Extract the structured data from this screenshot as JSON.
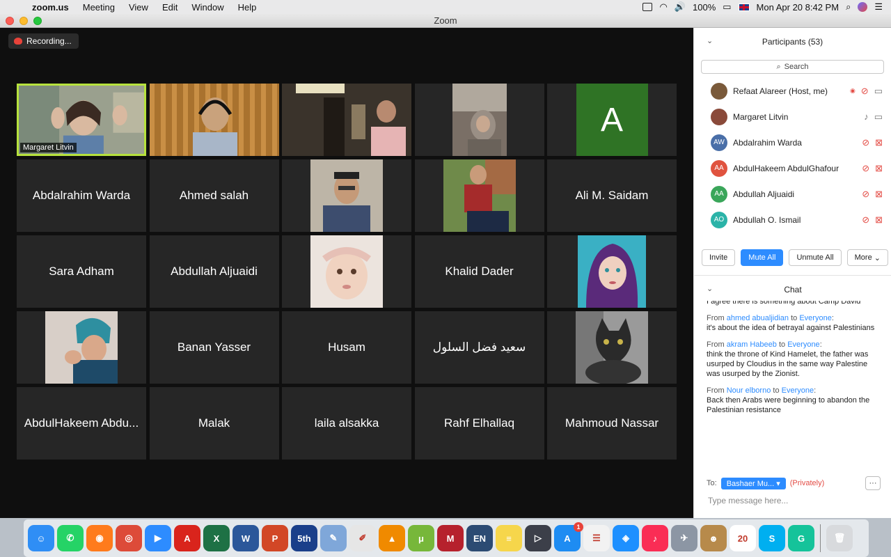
{
  "menubar": {
    "app_name": "zoom.us",
    "items": [
      "Meeting",
      "View",
      "Edit",
      "Window",
      "Help"
    ],
    "battery": "100%",
    "datetime": "Mon Apr 20  8:42 PM"
  },
  "window": {
    "title": "Zoom"
  },
  "recording": {
    "label": "Recording..."
  },
  "tiles": [
    {
      "name": "Margaret Litvin",
      "kind": "camera",
      "active": true,
      "scene": "margaret"
    },
    {
      "name": "",
      "kind": "camera",
      "scene": "ahmed"
    },
    {
      "name": "",
      "kind": "camera",
      "scene": "room"
    },
    {
      "name": "",
      "kind": "photo",
      "scene": "hijab-gray"
    },
    {
      "name": "A",
      "kind": "letter-avatar",
      "color": "#2f7325"
    },
    {
      "name": "Abdalrahim Warda",
      "kind": "name"
    },
    {
      "name": "Ahmed salah",
      "kind": "name"
    },
    {
      "name": "",
      "kind": "photo",
      "scene": "man-cap"
    },
    {
      "name": "",
      "kind": "photo",
      "scene": "man-red-jacket"
    },
    {
      "name": "Ali M. Saidam",
      "kind": "name"
    },
    {
      "name": "Sara Adham",
      "kind": "name"
    },
    {
      "name": "Abdullah Aljuaidi",
      "kind": "name"
    },
    {
      "name": "",
      "kind": "photo",
      "scene": "baby"
    },
    {
      "name": "Khalid Dader",
      "kind": "name"
    },
    {
      "name": "",
      "kind": "photo",
      "scene": "girl-hijab"
    },
    {
      "name": "",
      "kind": "photo",
      "scene": "boy-hat"
    },
    {
      "name": "Banan Yasser",
      "kind": "name"
    },
    {
      "name": "Husam",
      "kind": "name"
    },
    {
      "name": "سعيد فضل السلول",
      "kind": "name"
    },
    {
      "name": "",
      "kind": "photo",
      "scene": "cat"
    },
    {
      "name": "AbdulHakeem Abdu...",
      "kind": "name"
    },
    {
      "name": "Malak",
      "kind": "name"
    },
    {
      "name": "laila alsakka",
      "kind": "name"
    },
    {
      "name": "Rahf Elhallaq",
      "kind": "name"
    },
    {
      "name": "Mahmoud Nassar",
      "kind": "name"
    }
  ],
  "participants": {
    "title": "Participants (53)",
    "search_placeholder": "Search",
    "list": [
      {
        "name": "Refaat Alareer (Host, me)",
        "initials": "",
        "color": "#7a5a3a",
        "mic": "off",
        "cam": "on",
        "recording": true
      },
      {
        "name": "Margaret Litvin",
        "initials": "",
        "color": "#8a4a3a",
        "mic": "on",
        "cam": "on"
      },
      {
        "name": "Abdalrahim Warda",
        "initials": "AW",
        "color": "#4a6fa8",
        "mic": "off",
        "cam": "off"
      },
      {
        "name": "AbdulHakeem AbdulGhafour",
        "initials": "AA",
        "color": "#e0533f",
        "mic": "off",
        "cam": "off"
      },
      {
        "name": "Abdullah Aljuaidi",
        "initials": "AA",
        "color": "#3aa65a",
        "mic": "off",
        "cam": "off"
      },
      {
        "name": "Abdullah O. Ismail",
        "initials": "AO",
        "color": "#2bb3a8",
        "mic": "off",
        "cam": "off"
      }
    ],
    "buttons": {
      "invite": "Invite",
      "mute_all": "Mute All",
      "unmute_all": "Unmute All",
      "more": "More"
    }
  },
  "chat": {
    "title": "Chat",
    "partial_line": "I agree there is something about Camp David",
    "messages": [
      {
        "from": "ahmed abualjidian",
        "to": "Everyone",
        "text": "it's about the idea of betrayal against Palestinians"
      },
      {
        "from": "akram Habeeb",
        "to": "Everyone",
        "text": "think the throne of Kind Hamelet, the father was usurped by Cloudius in the same way Palestine was usurped by the Zionist."
      },
      {
        "from": "Nour elborno",
        "to": "Everyone",
        "text": "Back then Arabs were beginning to abandon the Palestinian resistance"
      }
    ],
    "from_label": "From",
    "to_label": "to",
    "send_to_label": "To:",
    "recipient": "Bashaer Mu...",
    "privately": "(Privately)",
    "input_placeholder": "Type message here..."
  },
  "dock": {
    "apps": [
      {
        "name": "finder",
        "color": "#2f8ef5",
        "glyph": "☺"
      },
      {
        "name": "whatsapp",
        "color": "#25d366",
        "glyph": "✆"
      },
      {
        "name": "firefox",
        "color": "#ff7b1c",
        "glyph": "◉"
      },
      {
        "name": "chrome",
        "color": "#dd4b39",
        "glyph": "◎"
      },
      {
        "name": "zoom",
        "color": "#2d8cff",
        "glyph": "▶"
      },
      {
        "name": "acrobat",
        "color": "#d9241c",
        "glyph": "A"
      },
      {
        "name": "excel",
        "color": "#1e7145",
        "glyph": "X"
      },
      {
        "name": "word",
        "color": "#2b579a",
        "glyph": "W"
      },
      {
        "name": "powerpoint",
        "color": "#d24726",
        "glyph": "P"
      },
      {
        "name": "longman",
        "color": "#1a3f8a",
        "glyph": "5th"
      },
      {
        "name": "preview",
        "color": "#7fa7d9",
        "glyph": "✎"
      },
      {
        "name": "textedit",
        "color": "#e6e6e6",
        "glyph": "✐"
      },
      {
        "name": "vlc",
        "color": "#f08a00",
        "glyph": "▲"
      },
      {
        "name": "utorrent",
        "color": "#77b73a",
        "glyph": "μ"
      },
      {
        "name": "mendeley",
        "color": "#b6212d",
        "glyph": "M"
      },
      {
        "name": "en-dictionary",
        "color": "#2c4b73",
        "glyph": "EN"
      },
      {
        "name": "notes",
        "color": "#f6d64b",
        "glyph": "≡"
      },
      {
        "name": "quicktime",
        "color": "#3c3f49",
        "glyph": "▷"
      },
      {
        "name": "app-store",
        "color": "#1e8cf2",
        "glyph": "A",
        "badge": "1"
      },
      {
        "name": "reminders",
        "color": "#f2f2f2",
        "glyph": "☰"
      },
      {
        "name": "safari",
        "color": "#1e90ff",
        "glyph": "◈"
      },
      {
        "name": "music",
        "color": "#fa2d55",
        "glyph": "♪"
      },
      {
        "name": "launchpad",
        "color": "#8c96a4",
        "glyph": "✈"
      },
      {
        "name": "contacts",
        "color": "#b78a4b",
        "glyph": "☻"
      },
      {
        "name": "calendar",
        "color": "#ffffff",
        "glyph": "20"
      },
      {
        "name": "skype",
        "color": "#00aff0",
        "glyph": "S"
      },
      {
        "name": "grammarly",
        "color": "#15c39a",
        "glyph": "G"
      }
    ],
    "trash": {
      "name": "trash",
      "color": "#d8dadd",
      "glyph": "🗑"
    }
  }
}
